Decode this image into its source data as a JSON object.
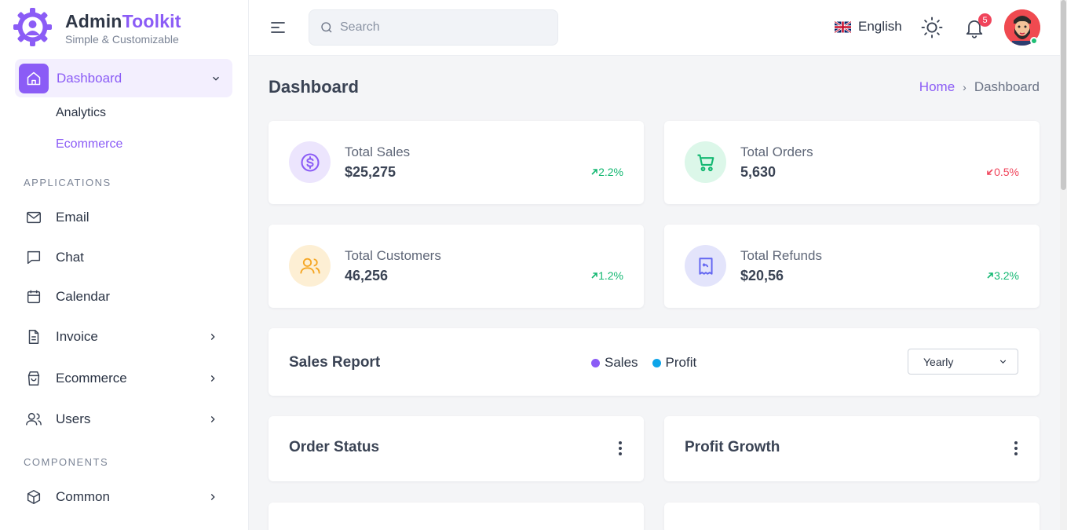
{
  "brand": {
    "name_main": "Admin",
    "name_accent": "Toolkit",
    "tagline": "Simple & Customizable"
  },
  "sidebar": {
    "active": {
      "label": "Dashboard"
    },
    "sub_items": [
      {
        "label": "Analytics"
      },
      {
        "label": "Ecommerce"
      }
    ],
    "section_applications": "APPLICATIONS",
    "apps": [
      {
        "label": "Email",
        "icon": "mail-icon"
      },
      {
        "label": "Chat",
        "icon": "chat-icon"
      },
      {
        "label": "Calendar",
        "icon": "calendar-icon"
      },
      {
        "label": "Invoice",
        "icon": "file-icon"
      },
      {
        "label": "Ecommerce",
        "icon": "shopping-bag-icon"
      },
      {
        "label": "Users",
        "icon": "users-icon"
      }
    ],
    "section_components": "COMPONENTS",
    "components": [
      {
        "label": "Common",
        "icon": "box-icon"
      }
    ]
  },
  "header": {
    "search_placeholder": "Search",
    "language": "English",
    "notification_count": "5"
  },
  "page": {
    "title": "Dashboard",
    "breadcrumb": {
      "home": "Home",
      "current": "Dashboard"
    }
  },
  "stats": [
    {
      "label": "Total Sales",
      "value": "$25,275",
      "change": "2.2%",
      "trend": "up",
      "color": "#8b5cf6"
    },
    {
      "label": "Total Orders",
      "value": "5,630",
      "change": "0.5%",
      "trend": "down",
      "color": "#22c55e"
    },
    {
      "label": "Total Customers",
      "value": "46,256",
      "change": "1.2%",
      "trend": "up",
      "color": "#f59e0b"
    },
    {
      "label": "Total Refunds",
      "value": "$20,56",
      "change": "3.2%",
      "trend": "up",
      "color": "#6366f1"
    }
  ],
  "sales_report": {
    "title": "Sales Report",
    "legend": [
      {
        "name": "Sales",
        "color": "#8b5cf6"
      },
      {
        "name": "Profit",
        "color": "#0ea5e9"
      }
    ],
    "period": "Yearly"
  },
  "panels": {
    "order_status": "Order Status",
    "profit_growth": "Profit Growth"
  },
  "colors": {
    "accent": "#8b5cf6",
    "up": "#14b872",
    "down": "#f0445b"
  }
}
